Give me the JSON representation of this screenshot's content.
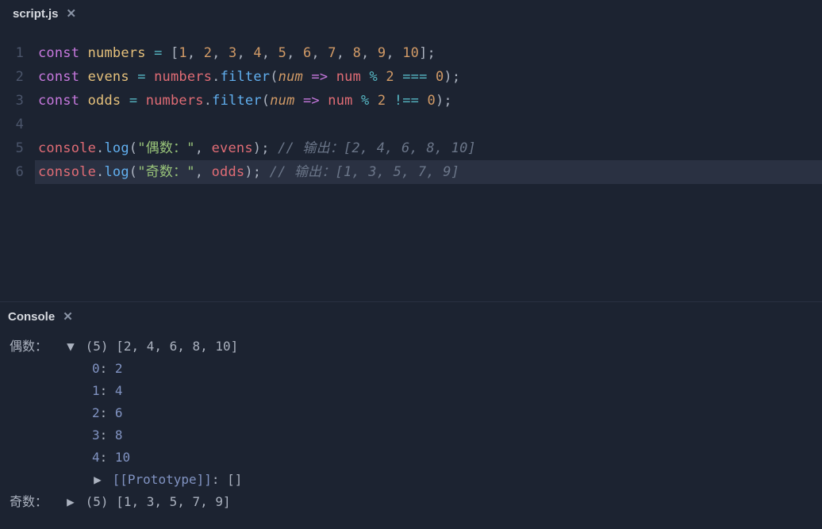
{
  "editor": {
    "tab": {
      "filename": "script.js"
    },
    "lines": {
      "count": 6
    },
    "code": {
      "l1": {
        "kw": "const",
        "name": "numbers",
        "eq": "=",
        "arr": "[1, 2, 3, 4, 5, 6, 7, 8, 9, 10]",
        "semi": ";"
      },
      "l2": {
        "kw": "const",
        "name": "evens",
        "eq": "=",
        "src": "numbers",
        "dot": ".",
        "fn": "filter",
        "open": "(",
        "param": "num",
        "arrow": "=>",
        "p2": "num",
        "mod": "%",
        "two": "2",
        "cmp": "===",
        "zero": "0",
        "close": ")",
        "semi": ";"
      },
      "l3": {
        "kw": "const",
        "name": "odds",
        "eq": "=",
        "src": "numbers",
        "dot": ".",
        "fn": "filter",
        "open": "(",
        "param": "num",
        "arrow": "=>",
        "p2": "num",
        "mod": "%",
        "two": "2",
        "cmp": "!==",
        "zero": "0",
        "close": ")",
        "semi": ";"
      },
      "l5": {
        "obj": "console",
        "dot": ".",
        "fn": "log",
        "open": "(",
        "str": "\"偶数：\"",
        "comma": ",",
        "arg": "evens",
        "close": ")",
        "semi": ";",
        "cmt": "// 输出：[2, 4, 6, 8, 10]"
      },
      "l6": {
        "obj": "console",
        "dot": ".",
        "fn": "log",
        "open": "(",
        "str": "\"奇数：\"",
        "comma": ",",
        "arg": "odds",
        "close": ")",
        "semi": ";",
        "cmt": "// 输出：[1, 3, 5, 7, 9]"
      }
    }
  },
  "console": {
    "title": "Console",
    "rows": [
      {
        "label": "偶数： ",
        "expanded": true,
        "length": "(5)",
        "preview": "[2, 4, 6, 8, 10]",
        "items": [
          {
            "idx": "0",
            "val": "2"
          },
          {
            "idx": "1",
            "val": "4"
          },
          {
            "idx": "2",
            "val": "6"
          },
          {
            "idx": "3",
            "val": "8"
          },
          {
            "idx": "4",
            "val": "10"
          }
        ],
        "proto": {
          "key": "[[Prototype]]",
          "val": "[]"
        }
      },
      {
        "label": "奇数： ",
        "expanded": false,
        "length": "(5)",
        "preview": "[1, 3, 5, 7, 9]"
      }
    ]
  },
  "gutter": [
    "1",
    "2",
    "3",
    "4",
    "5",
    "6"
  ]
}
